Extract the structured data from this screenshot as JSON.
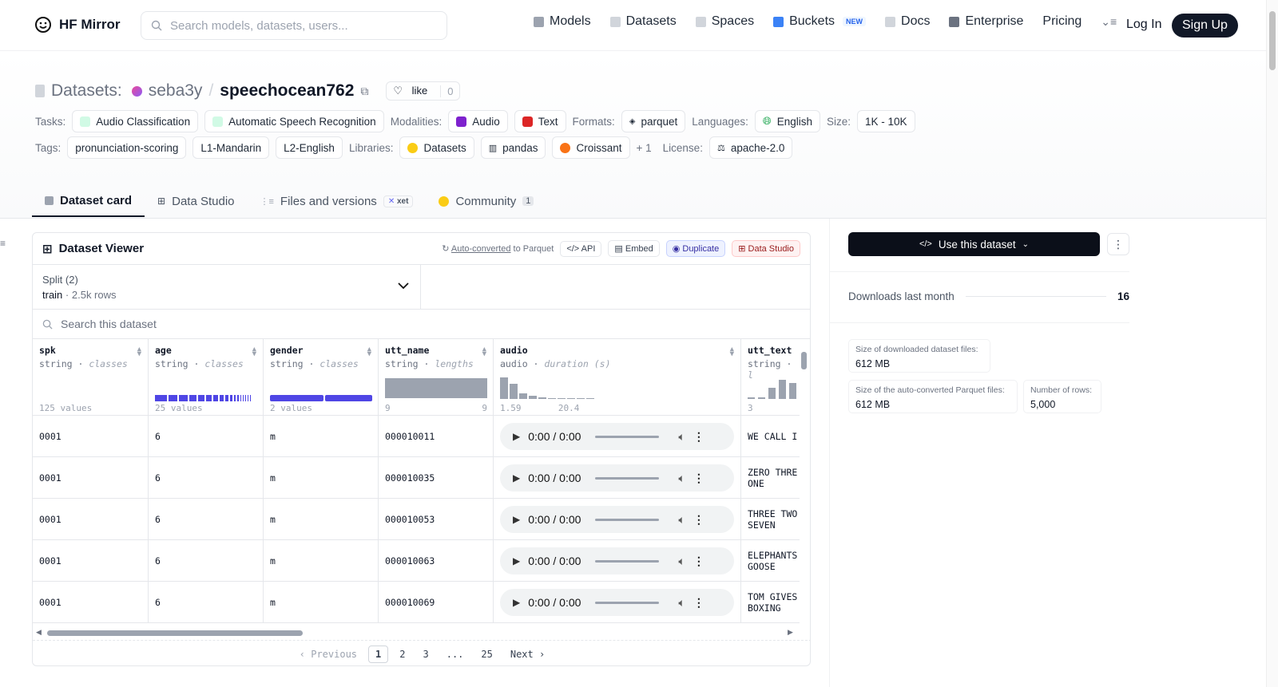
{
  "nav": {
    "brand": "HF Mirror",
    "search_placeholder": "Search models, datasets, users...",
    "links": [
      "Models",
      "Datasets",
      "Spaces",
      "Buckets",
      "Docs",
      "Enterprise",
      "Pricing"
    ],
    "new_badge": "NEW",
    "login": "Log In",
    "signup": "Sign Up"
  },
  "header": {
    "section": "Datasets:",
    "owner": "seba3y",
    "separator": "/",
    "name": "speechocean762",
    "like_label": "like",
    "like_count": "0"
  },
  "tags": {
    "tasks_label": "Tasks:",
    "tasks": [
      "Audio Classification",
      "Automatic Speech Recognition"
    ],
    "modalities_label": "Modalities:",
    "modalities": [
      "Audio",
      "Text"
    ],
    "formats_label": "Formats:",
    "formats": [
      "parquet"
    ],
    "languages_label": "Languages:",
    "languages": [
      "English"
    ],
    "size_label": "Size:",
    "size": "1K - 10K",
    "tags_label": "Tags:",
    "tags": [
      "pronunciation-scoring",
      "L1-Mandarin",
      "L2-English"
    ],
    "libraries_label": "Libraries:",
    "libraries": [
      "Datasets",
      "pandas",
      "Croissant"
    ],
    "libraries_more": "+ 1",
    "license_label": "License:",
    "license": "apache-2.0"
  },
  "tabs": [
    {
      "label": "Dataset card"
    },
    {
      "label": "Data Studio"
    },
    {
      "label": "Files and versions",
      "badge": "xet"
    },
    {
      "label": "Community",
      "badge": "1"
    }
  ],
  "viewer": {
    "title": "Dataset Viewer",
    "auto_converted": "Auto-converted",
    "to_parquet": "to Parquet",
    "api": "API",
    "embed": "Embed",
    "duplicate": "Duplicate",
    "data_studio": "Data Studio",
    "split_label": "Split (2)",
    "split_name": "train",
    "split_rows": "2.5k rows",
    "search_placeholder": "Search this dataset",
    "columns": [
      {
        "name": "spk",
        "type": "string",
        "stat": "classes",
        "footer": "125 values"
      },
      {
        "name": "age",
        "type": "string",
        "stat": "classes",
        "footer": "25 values"
      },
      {
        "name": "gender",
        "type": "string",
        "stat": "classes",
        "footer": "2 values"
      },
      {
        "name": "utt_name",
        "type": "string",
        "stat": "lengths",
        "footer_min": "9",
        "footer_max": "9"
      },
      {
        "name": "audio",
        "type": "audio",
        "stat": "duration (s)",
        "footer_min": "1.59",
        "footer_max": "20.4"
      },
      {
        "name": "utt_text",
        "type": "string",
        "stat": "l",
        "footer_min": "3"
      }
    ],
    "rows": [
      {
        "spk": "0001",
        "age": "6",
        "gender": "m",
        "utt_name": "000010011",
        "audio_time": "0:00 / 0:00",
        "utt_text": "WE CALL I"
      },
      {
        "spk": "0001",
        "age": "6",
        "gender": "m",
        "utt_name": "000010035",
        "audio_time": "0:00 / 0:00",
        "utt_text": "ZERO THRE\nONE"
      },
      {
        "spk": "0001",
        "age": "6",
        "gender": "m",
        "utt_name": "000010053",
        "audio_time": "0:00 / 0:00",
        "utt_text": "THREE TWO\nSEVEN"
      },
      {
        "spk": "0001",
        "age": "6",
        "gender": "m",
        "utt_name": "000010063",
        "audio_time": "0:00 / 0:00",
        "utt_text": "ELEPHANTS\nGOOSE"
      },
      {
        "spk": "0001",
        "age": "6",
        "gender": "m",
        "utt_name": "000010069",
        "audio_time": "0:00 / 0:00",
        "utt_text": "TOM GIVES\nBOXING"
      }
    ],
    "pager": {
      "prev": "Previous",
      "pages": [
        "1",
        "2",
        "3",
        "...",
        "25"
      ],
      "next": "Next"
    }
  },
  "sidebar": {
    "use_button": "Use this dataset",
    "downloads_label": "Downloads last month",
    "downloads_value": "16",
    "dl_size_label": "Size of downloaded dataset files:",
    "dl_size_value": "612 MB",
    "parquet_size_label": "Size of the auto-converted Parquet files:",
    "parquet_size_value": "612 MB",
    "rows_label": "Number of rows:",
    "rows_value": "5,000"
  },
  "colors": {
    "accent": "#4f46e5",
    "dark": "#0b0f19",
    "histogram": "#9ca3af"
  },
  "icons": [
    "search-icon",
    "like-heart-icon",
    "copy-icon",
    "table-icon",
    "chevron-down-icon",
    "play-icon",
    "volume-icon",
    "kebab-icon"
  ]
}
